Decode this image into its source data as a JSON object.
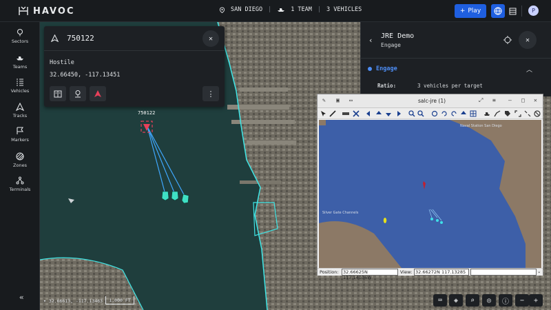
{
  "app": {
    "logo_text": "HAVOC",
    "location": "SAN DIEGO",
    "teams": "1 TEAM",
    "vehicles": "3 VEHICLES",
    "play_label": "Play",
    "avatar_initial": "P",
    "accent_color": "#1f5fe0"
  },
  "sidebar": {
    "items": [
      {
        "label": "Sectors",
        "icon": "map-pin-icon"
      },
      {
        "label": "Teams",
        "icon": "boat-icon"
      },
      {
        "label": "Vehicles",
        "icon": "list-icon"
      },
      {
        "label": "Tracks",
        "icon": "triangle-icon"
      },
      {
        "label": "Markers",
        "icon": "flag-icon"
      },
      {
        "label": "Zones",
        "icon": "hatched-circle-icon"
      },
      {
        "label": "Terminals",
        "icon": "network-icon"
      }
    ],
    "collapse_label": "«"
  },
  "track": {
    "id": "750122",
    "status": "Hostile",
    "coords": "32.66450, -117.13451",
    "map_label": "750122",
    "hostile_color": "#e8405a"
  },
  "engage_panel": {
    "title": "JRE Demo",
    "subtitle": "Engage",
    "section": "Engage",
    "ratio_label": "Ratio:",
    "ratio_value": "3 vehicles per target"
  },
  "sim": {
    "title": "salc-jre (1)",
    "label_top": "Naval Station San Diego",
    "label_left": "Silver Gate Channels",
    "position_label": "Position:",
    "position_value": "32.66625N 117.14036W",
    "view_label": "View:",
    "view_value": "32.66272N 117.13285"
  },
  "map": {
    "coord_readout": "32.66613, -117.13463",
    "scale": "1,000 FT"
  }
}
